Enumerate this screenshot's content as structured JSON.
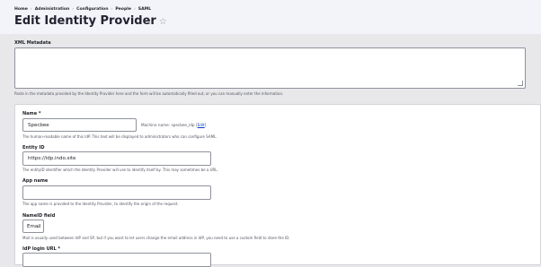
{
  "breadcrumb": [
    "Home",
    "Administration",
    "Configuration",
    "People",
    "SAML"
  ],
  "title": "Edit Identity Provider",
  "xml_metadata": {
    "label": "XML Metadata",
    "value": "",
    "description": "Paste in the metadata provided by the Identity Provider here and the form will be automatically filled out, or you can manually enter the information."
  },
  "name": {
    "label": "Name *",
    "value": "Specbee",
    "machine_name_label": "Machine name: specbee_idp",
    "edit_label": "Edit",
    "description": "The human-readable name of this IdP. This text will be displayed to administrators who can configure SAML."
  },
  "entity_id": {
    "label": "Entity ID",
    "value": "https://idp.indo.site",
    "description": "The entityID identifier which the Identity Provider will use to identify itself by. This may sometimes be a URL."
  },
  "app_name": {
    "label": "App name",
    "value": "",
    "description": "The app name is provided to the Identity Provider, to identify the origin of the request."
  },
  "nameid_field": {
    "label": "NameID field",
    "selected": "Email",
    "description": "Mail is usually used between IdP and SP, but if you want to let users change the email address in IdP, you need to use a custom field to store the ID."
  },
  "idp_login_url": {
    "label": "IdP login URL *"
  }
}
